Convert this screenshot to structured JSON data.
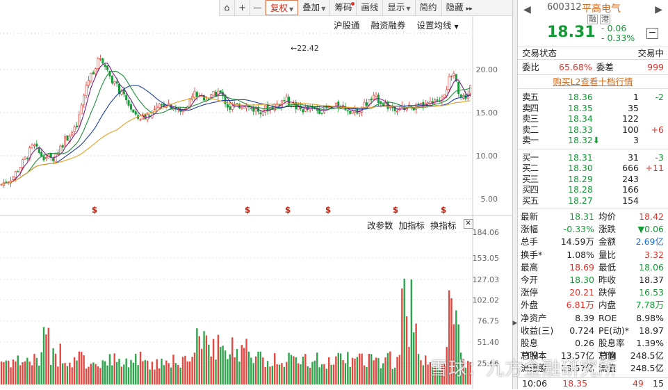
{
  "toolbar": {
    "items": [
      {
        "label": "复权",
        "active": true,
        "dropdown": true
      },
      {
        "label": "叠加",
        "dropdown": true
      },
      {
        "label": "筹码",
        "dot": true
      },
      {
        "label": "画线"
      },
      {
        "label": "显示",
        "dropdown": true
      },
      {
        "label": "简约"
      },
      {
        "label": "隐藏",
        "arrow": "▸▸"
      }
    ]
  },
  "subbar": {
    "hgt": "沪股通",
    "margin": "融资融券",
    "ma": "设置均线"
  },
  "indicator_bar": {
    "params": "改参数",
    "add": "加指标",
    "switch": "换指标"
  },
  "chart_data": {
    "type": "candlestick",
    "price_ticks": [
      "20.00",
      "15.00",
      "10.00",
      "5.00"
    ],
    "volume_ticks": [
      "184.06",
      "153.05",
      "127.03",
      "102.02",
      "76.75",
      "51.40",
      "25.66"
    ],
    "peak_label": "22.42",
    "marker": "$",
    "colors": {
      "up": "#e0332a",
      "down": "#159a37",
      "ma1": "#7a1f86",
      "ma2": "#1f3f9e",
      "ma3": "#1e8f3a",
      "ma4": "#e8a020"
    }
  },
  "quote": {
    "code": "600312",
    "name": "平高电气",
    "tags": [
      "融",
      "港"
    ],
    "price": "18.31",
    "change": "- 0.06",
    "change_pct": "- 0.33%",
    "status_label": "交易状态",
    "status_value": "交易中",
    "ratio_label": "委比",
    "ratio_value": "65.68%",
    "diff_label": "委差",
    "diff_value": "999",
    "l2_link": "购买L2查看十档行情",
    "asks": [
      {
        "label": "卖五",
        "price": "18.36",
        "vol": "1",
        "chg": "-2"
      },
      {
        "label": "卖四",
        "price": "18.35",
        "vol": "35",
        "chg": ""
      },
      {
        "label": "卖三",
        "price": "18.34",
        "vol": "122",
        "chg": ""
      },
      {
        "label": "卖二",
        "price": "18.33",
        "vol": "100",
        "chg": "+6"
      },
      {
        "label": "卖一",
        "price": "18.32⬇",
        "vol": "3",
        "chg": ""
      }
    ],
    "bids": [
      {
        "label": "买一",
        "price": "18.31",
        "vol": "31",
        "chg": "-3"
      },
      {
        "label": "买二",
        "price": "18.30",
        "vol": "666",
        "chg": "+11"
      },
      {
        "label": "买三",
        "price": "18.29",
        "vol": "243",
        "chg": ""
      },
      {
        "label": "买四",
        "price": "18.28",
        "vol": "166",
        "chg": ""
      },
      {
        "label": "买五",
        "price": "18.27",
        "vol": "154",
        "chg": ""
      }
    ],
    "stats": [
      [
        "最新",
        "18.31",
        "均价",
        "18.42"
      ],
      [
        "涨幅",
        "-0.33%",
        "涨跌",
        "▼0.06"
      ],
      [
        "总手",
        "14.59万",
        "金额",
        "2.69亿"
      ],
      [
        "换手*",
        "1.08%",
        "量比",
        "3.32"
      ],
      [
        "最高",
        "18.69",
        "最低",
        "18.06"
      ],
      [
        "今开",
        "18.30",
        "昨收",
        "18.37"
      ],
      [
        "涨停",
        "20.21",
        "跌停",
        "16.53"
      ],
      [
        "外盘",
        "6.81万",
        "内盘",
        "7.78万"
      ],
      [
        "净资产",
        "8.39",
        "ROE",
        "8.98%"
      ],
      [
        "收益(三)",
        "0.724",
        "PE(动)*",
        "18.97"
      ],
      [
        "股息TTM",
        "0.26",
        "股息率TTM",
        "1.39%"
      ],
      [
        "总股本",
        "13.57亿",
        "总值",
        "248.5亿"
      ],
      [
        "流通股",
        "13.57亿",
        "流值",
        "248.5亿"
      ]
    ],
    "tick": {
      "time": "10:06",
      "price": "18.35",
      "vol": "49",
      "num": "15"
    }
  },
  "watermark": "雪球：九方金融研究所"
}
